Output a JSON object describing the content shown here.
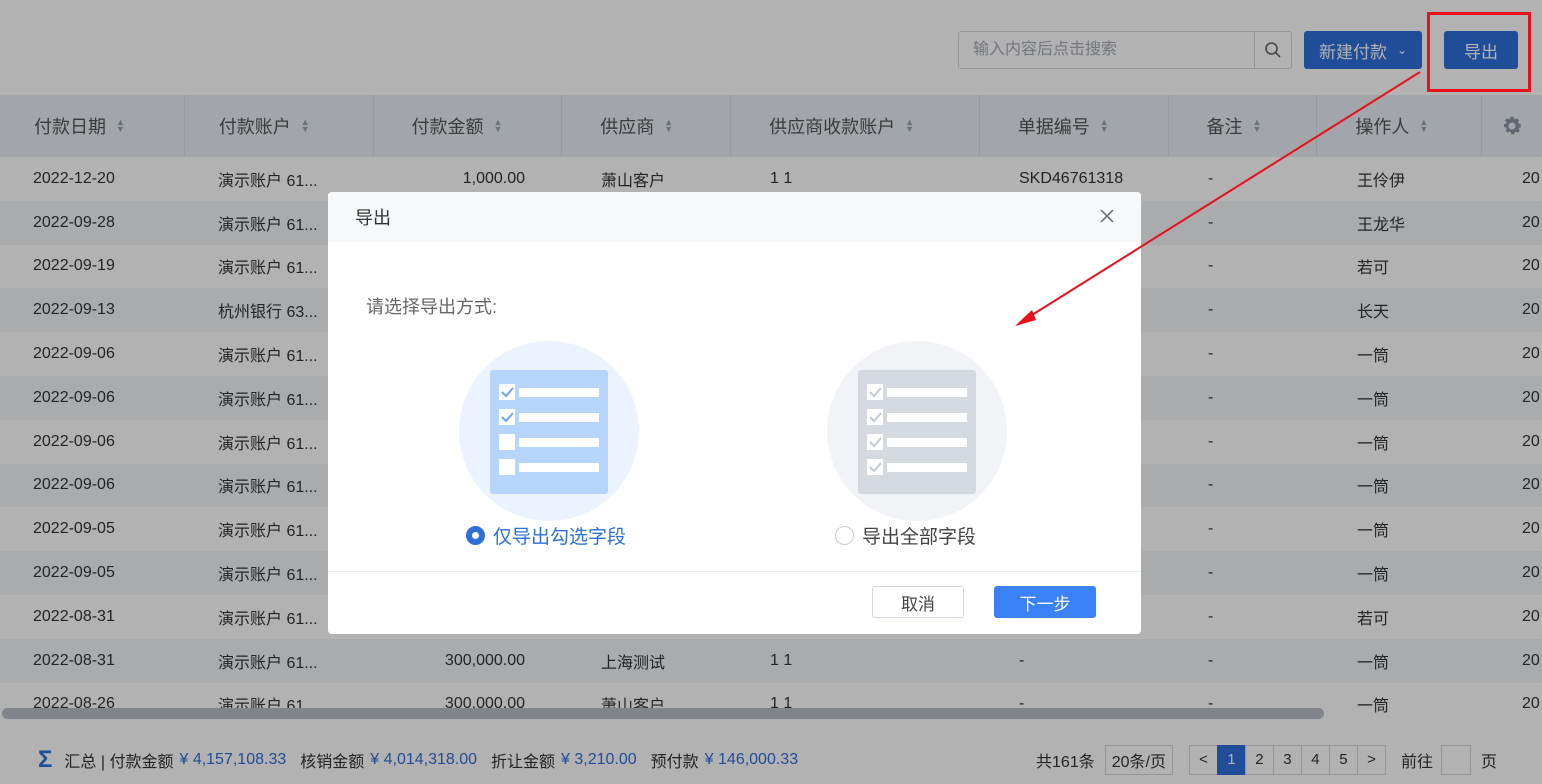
{
  "toolbar": {
    "search_placeholder": "输入内容后点击搜索",
    "new_payment_label": "新建付款",
    "export_label": "导出"
  },
  "table": {
    "columns": [
      {
        "label": "付款日期"
      },
      {
        "label": "付款账户"
      },
      {
        "label": "付款金额"
      },
      {
        "label": "供应商"
      },
      {
        "label": "供应商收款账户"
      },
      {
        "label": "单据编号"
      },
      {
        "label": "备注"
      },
      {
        "label": "操作人"
      }
    ],
    "rows": [
      {
        "date": "2022-12-20",
        "account": "演示账户 61...",
        "amount": "1,000.00",
        "supplier": "萧山客户",
        "supplier_account": "1 1",
        "doc_no": "SKD46761318",
        "note": "-",
        "operator": "王伶伊",
        "extra": "20"
      },
      {
        "date": "2022-09-28",
        "account": "演示账户 61...",
        "amount": "",
        "supplier": "",
        "supplier_account": "",
        "doc_no": "",
        "note": "-",
        "operator": "王龙华",
        "extra": "20"
      },
      {
        "date": "2022-09-19",
        "account": "演示账户 61...",
        "amount": "",
        "supplier": "",
        "supplier_account": "",
        "doc_no": "",
        "note": "-",
        "operator": "若可",
        "extra": "20"
      },
      {
        "date": "2022-09-13",
        "account": "杭州银行 63...",
        "amount": "",
        "supplier": "",
        "supplier_account": "",
        "doc_no": "",
        "note": "-",
        "operator": "长天",
        "extra": "20"
      },
      {
        "date": "2022-09-06",
        "account": "演示账户 61...",
        "amount": "",
        "supplier": "",
        "supplier_account": "",
        "doc_no": "",
        "note": "-",
        "operator": "一筒",
        "extra": "20"
      },
      {
        "date": "2022-09-06",
        "account": "演示账户 61...",
        "amount": "",
        "supplier": "",
        "supplier_account": "",
        "doc_no": "",
        "note": "-",
        "operator": "一筒",
        "extra": "20"
      },
      {
        "date": "2022-09-06",
        "account": "演示账户 61...",
        "amount": "",
        "supplier": "",
        "supplier_account": "",
        "doc_no": "",
        "note": "-",
        "operator": "一筒",
        "extra": "20"
      },
      {
        "date": "2022-09-06",
        "account": "演示账户 61...",
        "amount": "",
        "supplier": "",
        "supplier_account": "",
        "doc_no": "",
        "note": "-",
        "operator": "一筒",
        "extra": "20"
      },
      {
        "date": "2022-09-05",
        "account": "演示账户 61...",
        "amount": "",
        "supplier": "",
        "supplier_account": "",
        "doc_no": "",
        "note": "-",
        "operator": "一筒",
        "extra": "20"
      },
      {
        "date": "2022-09-05",
        "account": "演示账户 61...",
        "amount": "",
        "supplier": "",
        "supplier_account": "",
        "doc_no": "",
        "note": "-",
        "operator": "一筒",
        "extra": "20"
      },
      {
        "date": "2022-08-31",
        "account": "演示账户 61...",
        "amount": "",
        "supplier": "",
        "supplier_account": "",
        "doc_no": "",
        "note": "-",
        "operator": "若可",
        "extra": "20"
      },
      {
        "date": "2022-08-31",
        "account": "演示账户 61...",
        "amount": "300,000.00",
        "supplier": "上海测试",
        "supplier_account": "1 1",
        "doc_no": "-",
        "note": "-",
        "operator": "一筒",
        "extra": "20"
      },
      {
        "date": "2022-08-26",
        "account": "演示账户 61...",
        "amount": "300,000.00",
        "supplier": "萧山客户",
        "supplier_account": "1 1",
        "doc_no": "-",
        "note": "-",
        "operator": "一筒",
        "extra": "20"
      }
    ]
  },
  "summary": {
    "sigma": "Σ",
    "prefix": "汇总 | 付款金额",
    "payment_amount": "¥ 4,157,108.33",
    "writeoff_label": "核销金额",
    "writeoff_amount": "¥ 4,014,318.00",
    "discount_label": "折让金额",
    "discount_amount": "¥ 3,210.00",
    "prepay_label": "预付款",
    "prepay_amount": "¥ 146,000.33"
  },
  "pager": {
    "total": "共161条",
    "page_size": "20条/页",
    "prev": "<",
    "pages": [
      "1",
      "2",
      "3",
      "4",
      "5"
    ],
    "current": "1",
    "next": ">",
    "goto_label": "前往",
    "goto_value": "",
    "goto_unit": "页"
  },
  "dialog": {
    "title": "导出",
    "prompt": "请选择导出方式:",
    "option_selected": "仅导出勾选字段",
    "option_all": "导出全部字段",
    "cancel_label": "取消",
    "next_label": "下一步"
  },
  "colors": {
    "primary": "#2f6fd8",
    "annotation_red": "#e8101a"
  }
}
